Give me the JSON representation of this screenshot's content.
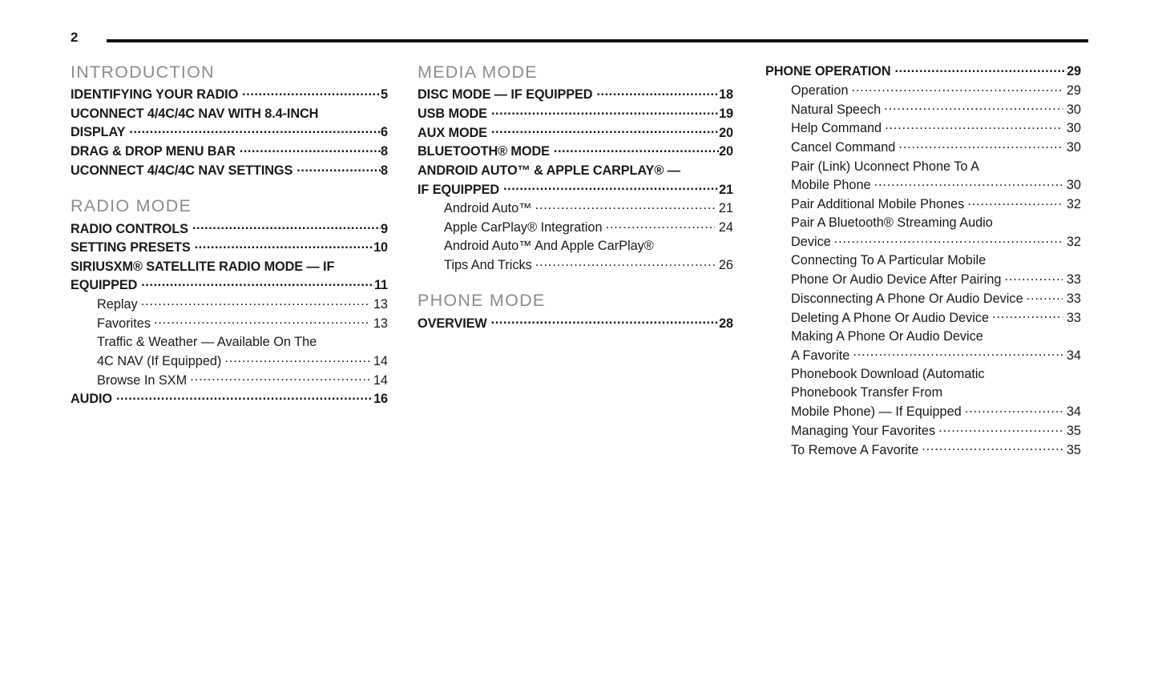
{
  "document": {
    "kind": "table-of-contents",
    "page_label": "2",
    "text_color": "#1a1a1a",
    "heading_color": "#8d8d8d",
    "rule_color": "#111111"
  },
  "columns": [
    {
      "name": "column-1",
      "sections": [
        {
          "heading": "INTRODUCTION",
          "entries": [
            {
              "type": "major",
              "label": "IDENTIFYING YOUR RADIO",
              "page": "5"
            },
            {
              "type": "major",
              "label": "UCONNECT 4/4C/4C NAV WITH 8.4-INCH",
              "page": "",
              "continued": true
            },
            {
              "type": "major",
              "label": "DISPLAY",
              "page": "6"
            },
            {
              "type": "major",
              "label": "DRAG & DROP MENU BAR",
              "page": "8"
            },
            {
              "type": "major",
              "label": "UCONNECT 4/4C/4C NAV SETTINGS",
              "page": "8"
            }
          ]
        },
        {
          "heading": "RADIO MODE",
          "entries": [
            {
              "type": "major",
              "label": "RADIO CONTROLS",
              "page": "9"
            },
            {
              "type": "major",
              "label": "SETTING PRESETS",
              "page": "10"
            },
            {
              "type": "major",
              "label": "SIRIUSXM® SATELLITE RADIO MODE — IF",
              "page": "",
              "continued": true
            },
            {
              "type": "major",
              "label": "EQUIPPED",
              "page": "11"
            },
            {
              "type": "sub",
              "label": "Replay",
              "page": "13"
            },
            {
              "type": "sub",
              "label": "Favorites",
              "page": "13"
            },
            {
              "type": "sub",
              "label": "Traffic & Weather — Available On The",
              "page": "",
              "continued": true
            },
            {
              "type": "sub",
              "label": "4C NAV (If Equipped)",
              "page": "14"
            },
            {
              "type": "sub",
              "label": "Browse In SXM",
              "page": "14"
            },
            {
              "type": "major",
              "label": "AUDIO",
              "page": "16"
            }
          ]
        }
      ]
    },
    {
      "name": "column-2",
      "sections": [
        {
          "heading": "MEDIA MODE",
          "entries": [
            {
              "type": "major",
              "label": "DISC MODE — IF EQUIPPED",
              "page": "18"
            },
            {
              "type": "major",
              "label": "USB MODE",
              "page": "19"
            },
            {
              "type": "major",
              "label": "AUX MODE",
              "page": "20"
            },
            {
              "type": "major",
              "label": "BLUETOOTH® MODE",
              "page": "20"
            },
            {
              "type": "major",
              "label": "ANDROID AUTO™ & APPLE CARPLAY® —",
              "page": "",
              "continued": true
            },
            {
              "type": "major",
              "label": "IF EQUIPPED",
              "page": "21"
            },
            {
              "type": "sub",
              "label": "Android Auto™",
              "page": "21"
            },
            {
              "type": "sub",
              "label": "Apple CarPlay® Integration",
              "page": "24"
            },
            {
              "type": "sub",
              "label": "Android Auto™ And Apple CarPlay®",
              "page": "",
              "continued": true
            },
            {
              "type": "sub",
              "label": "Tips And Tricks",
              "page": "26"
            }
          ]
        },
        {
          "heading": "PHONE MODE",
          "entries": [
            {
              "type": "major",
              "label": "OVERVIEW",
              "page": "28"
            }
          ]
        }
      ]
    },
    {
      "name": "column-3",
      "sections": [
        {
          "heading": "",
          "entries": [
            {
              "type": "major",
              "label": "PHONE OPERATION",
              "page": "29"
            },
            {
              "type": "sub",
              "label": "Operation",
              "page": "29"
            },
            {
              "type": "sub",
              "label": "Natural Speech",
              "page": "30"
            },
            {
              "type": "sub",
              "label": "Help Command",
              "page": "30"
            },
            {
              "type": "sub",
              "label": "Cancel Command",
              "page": "30"
            },
            {
              "type": "sub",
              "label": "Pair (Link) Uconnect Phone To A",
              "page": "",
              "continued": true
            },
            {
              "type": "sub",
              "label": "Mobile Phone",
              "page": "30"
            },
            {
              "type": "sub",
              "label": "Pair Additional Mobile Phones",
              "page": "32"
            },
            {
              "type": "sub",
              "label": "Pair A Bluetooth® Streaming Audio",
              "page": "",
              "continued": true
            },
            {
              "type": "sub",
              "label": "Device",
              "page": "32"
            },
            {
              "type": "sub",
              "label": "Connecting To A Particular Mobile",
              "page": "",
              "continued": true
            },
            {
              "type": "sub",
              "label": "Phone Or Audio Device After Pairing",
              "page": "33"
            },
            {
              "type": "sub",
              "label": "Disconnecting A Phone Or Audio Device",
              "page": "33"
            },
            {
              "type": "sub",
              "label": "Deleting A Phone Or Audio Device",
              "page": "33"
            },
            {
              "type": "sub",
              "label": "Making A Phone Or Audio Device",
              "page": "",
              "continued": true
            },
            {
              "type": "sub",
              "label": "A Favorite",
              "page": "34"
            },
            {
              "type": "sub",
              "label": "Phonebook Download (Automatic",
              "page": "",
              "continued": true
            },
            {
              "type": "sub",
              "label": "Phonebook Transfer From",
              "page": "",
              "continued": true
            },
            {
              "type": "sub",
              "label": "Mobile Phone) — If Equipped",
              "page": "34"
            },
            {
              "type": "sub",
              "label": "Managing Your Favorites",
              "page": "35"
            },
            {
              "type": "sub",
              "label": "To Remove A Favorite",
              "page": "35"
            }
          ]
        }
      ]
    }
  ]
}
